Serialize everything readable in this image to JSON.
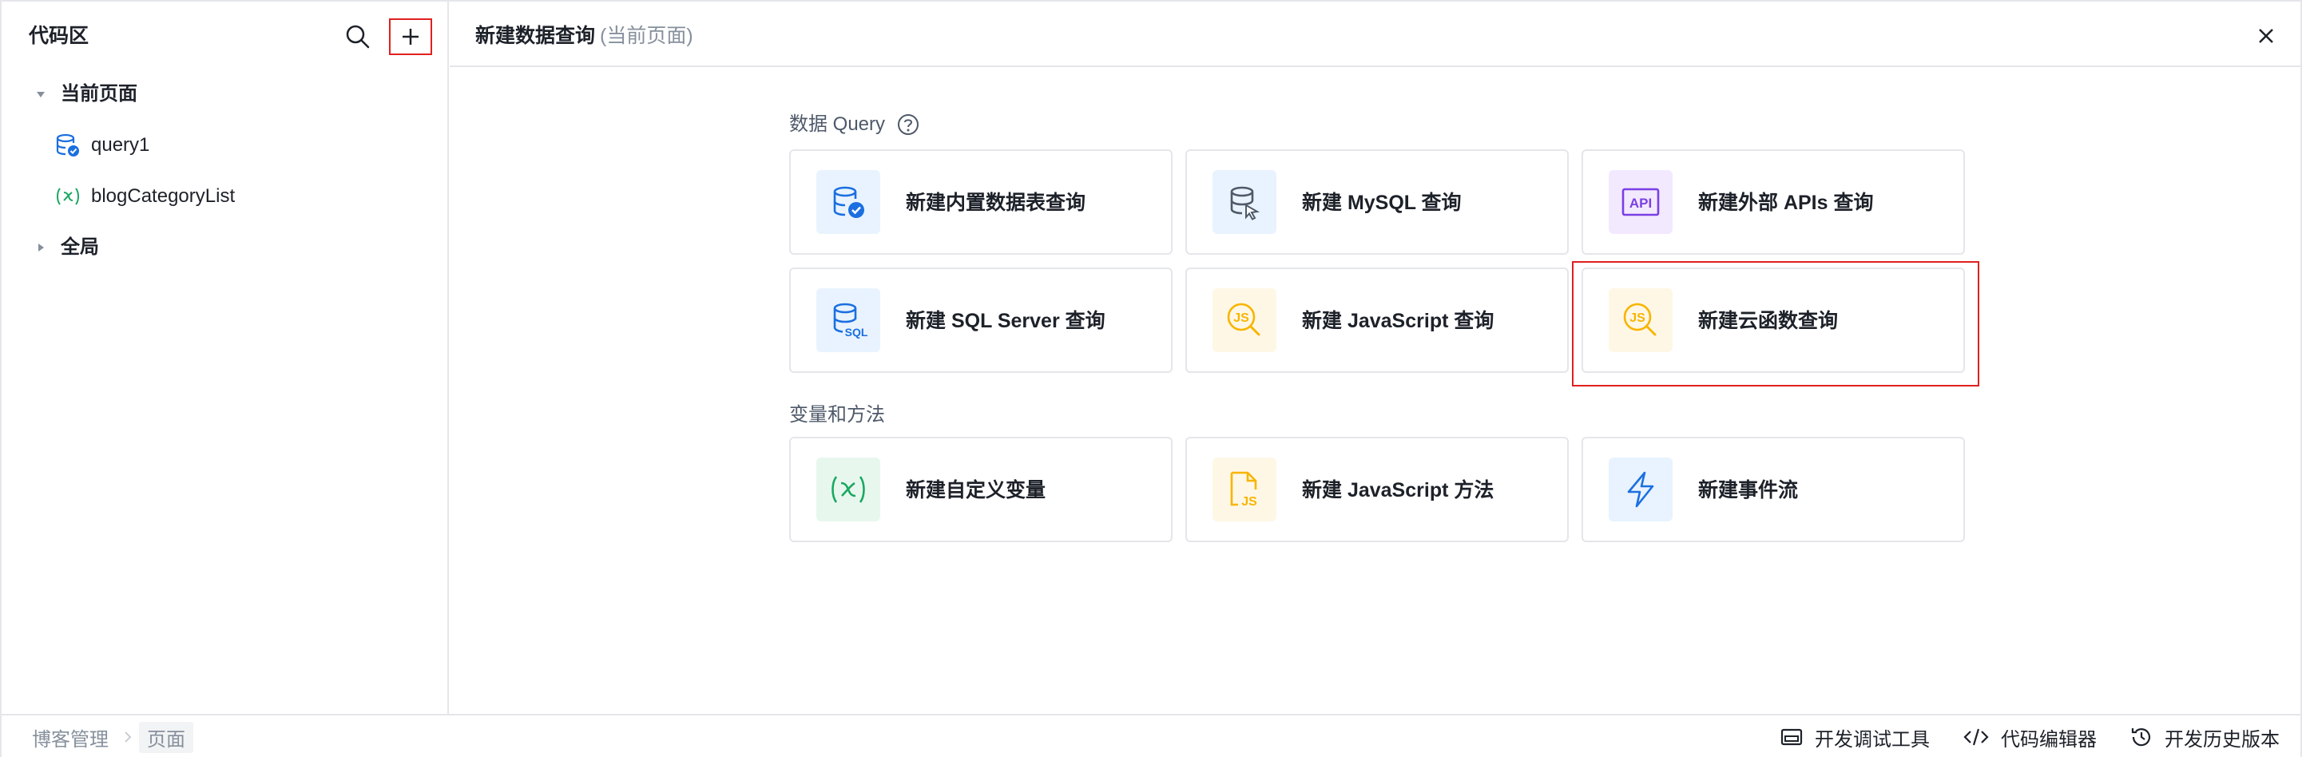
{
  "sidebar": {
    "title": "代码区",
    "tree": {
      "current_page": {
        "label": "当前页面",
        "expanded": true
      },
      "items": [
        {
          "label": "query1",
          "icon": "database-query-icon"
        },
        {
          "label": "blogCategoryList",
          "icon": "variable-icon"
        }
      ],
      "global": {
        "label": "全局",
        "expanded": false
      }
    }
  },
  "main": {
    "title": "新建数据查询",
    "subtitle": "(当前页面)",
    "sections": {
      "query": {
        "title": "数据 Query",
        "cards": [
          {
            "label": "新建内置数据表查询",
            "icon": "builtin-database-icon"
          },
          {
            "label": "新建 MySQL 查询",
            "icon": "mysql-database-icon"
          },
          {
            "label": "新建外部 APIs 查询",
            "icon": "api-icon"
          },
          {
            "label": "新建 SQL Server 查询",
            "icon": "sql-server-icon"
          },
          {
            "label": "新建 JavaScript 查询",
            "icon": "javascript-query-icon"
          },
          {
            "label": "新建云函数查询",
            "icon": "cloud-function-query-icon"
          }
        ]
      },
      "variables": {
        "title": "变量和方法",
        "cards": [
          {
            "label": "新建自定义变量",
            "icon": "custom-variable-icon"
          },
          {
            "label": "新建 JavaScript 方法",
            "icon": "javascript-file-icon"
          },
          {
            "label": "新建事件流",
            "icon": "lightning-icon"
          }
        ]
      }
    }
  },
  "footer": {
    "breadcrumb": [
      "博客管理",
      "页面"
    ],
    "tools": [
      {
        "label": "开发调试工具",
        "icon": "debug-panel-icon"
      },
      {
        "label": "代码编辑器",
        "icon": "code-icon"
      },
      {
        "label": "开发历史版本",
        "icon": "history-icon"
      }
    ]
  },
  "colors": {
    "accent_blue": "#1b6fe0",
    "js_yellow": "#f7b500",
    "api_purple": "#7b3fe4",
    "variable_green": "#1ba862",
    "highlight_red": "#e02020"
  }
}
